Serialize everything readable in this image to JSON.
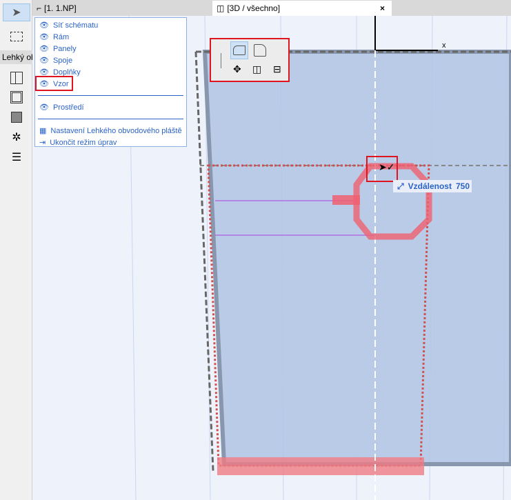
{
  "toolbar": {
    "tab_label": "Lehký ob"
  },
  "tabs": {
    "floor_plan": "[1. 1.NP]",
    "view_3d": "[3D / všechno]",
    "close": "×"
  },
  "menu": {
    "items": [
      {
        "label": "Síť schématu",
        "icon": "eye-icon"
      },
      {
        "label": "Rám",
        "icon": "eye-icon"
      },
      {
        "label": "Panely",
        "icon": "eye-icon"
      },
      {
        "label": "Spoje",
        "icon": "eye-icon"
      },
      {
        "label": "Doplňky",
        "icon": "eye-icon"
      },
      {
        "label": "Vzor",
        "icon": "eye-icon"
      }
    ],
    "environment": "Prostředí",
    "settings": "Nastavení Lehkého obvodového pláště",
    "exit": "Ukončit režim úprav"
  },
  "axis": {
    "x_label": "x"
  },
  "tooltip": {
    "label": "Vzdálenost",
    "value": "750"
  },
  "colors": {
    "accent": "#2a63c7",
    "highlight": "#e0141e",
    "panel": "#b8cae6"
  }
}
